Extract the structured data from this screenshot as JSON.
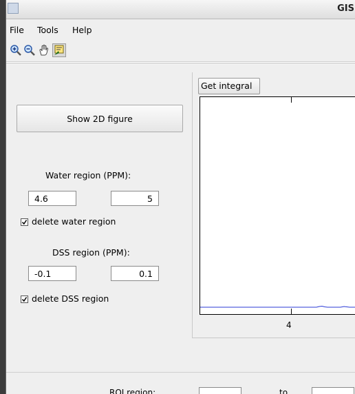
{
  "window": {
    "title": "GIS"
  },
  "menu": [
    "File",
    "Tools",
    "Help"
  ],
  "toolbar": {
    "icons": [
      "zoom-in-icon",
      "zoom-out-icon",
      "pan-hand-icon",
      "data-cursor-icon"
    ]
  },
  "left_panel": {
    "show_2d_label": "Show 2D figure",
    "water": {
      "label": "Water region (PPM):",
      "from": "4.6",
      "to": "5",
      "delete_label": "delete water region",
      "delete_checked": true
    },
    "dss": {
      "label": "DSS region (PPM):",
      "from": "-0.1",
      "to": "0.1",
      "delete_label": "delete DSS region",
      "delete_checked": true
    },
    "roi": {
      "label": "ROI region:",
      "to_label": "to"
    }
  },
  "plot": {
    "button_label": "Get integral",
    "x_tick_label": "4",
    "line_color": "#2a3ad6"
  }
}
